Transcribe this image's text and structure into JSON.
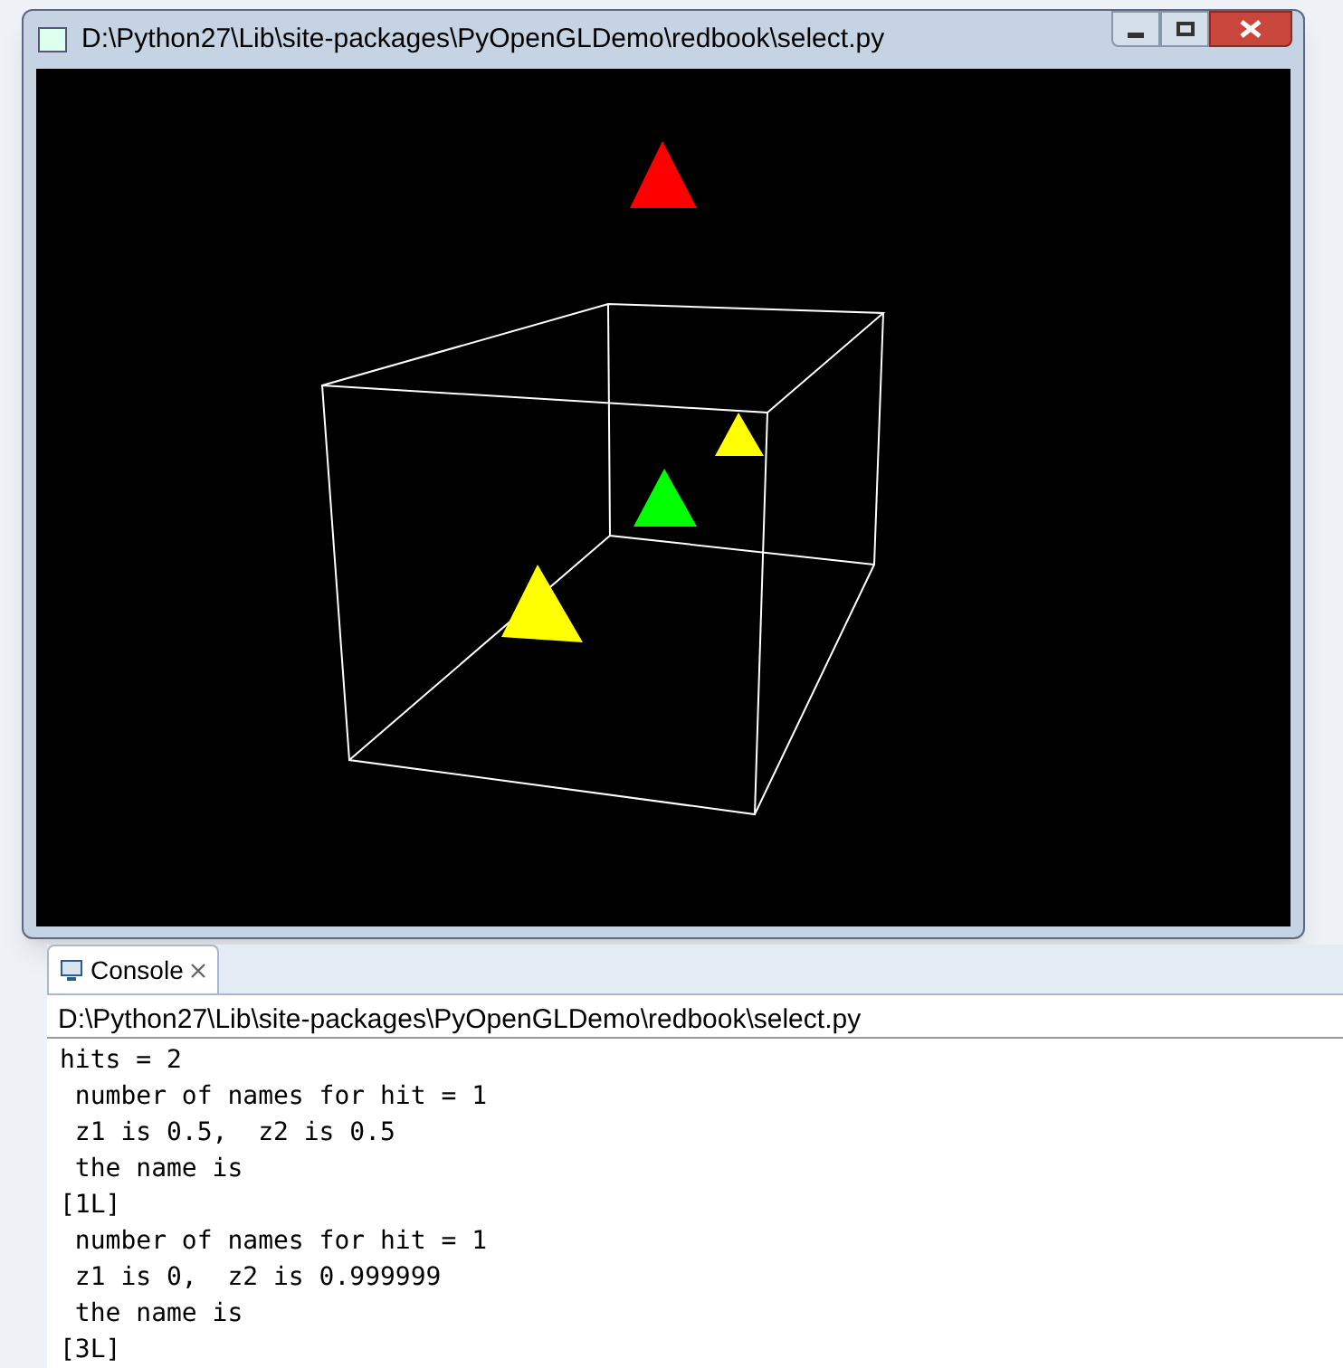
{
  "window": {
    "title": "D:\\Python27\\Lib\\site-packages\\PyOpenGLDemo\\redbook\\select.py"
  },
  "console": {
    "tab": {
      "label": "Console",
      "selected": true
    },
    "path": "D:\\Python27\\Lib\\site-packages\\PyOpenGLDemo\\redbook\\select.py",
    "lines": [
      "hits = 2",
      " number of names for hit = 1",
      " z1 is 0.5,  z2 is 0.5",
      " the name is",
      "[1L]",
      " number of names for hit = 1",
      " z1 is 0,  z2 is 0.999999",
      " the name is",
      "[3L]"
    ]
  }
}
